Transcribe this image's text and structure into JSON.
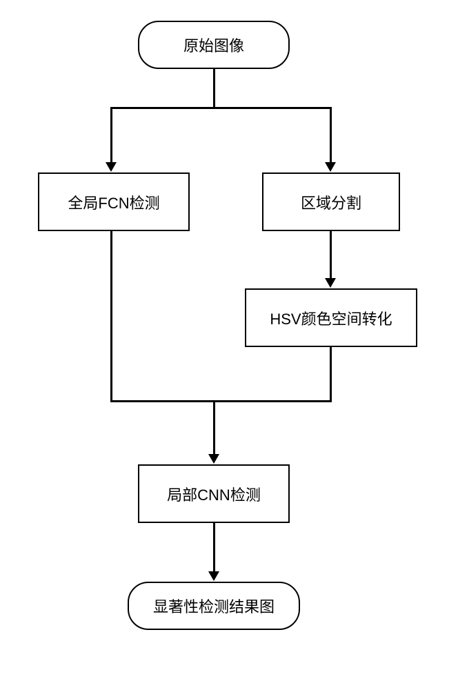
{
  "nodes": {
    "start": "原始图像",
    "fcn": "全局FCN检测",
    "segment": "区域分割",
    "hsv": "HSV颜色空间转化",
    "cnn": "局部CNN检测",
    "result": "显著性检测结果图"
  }
}
